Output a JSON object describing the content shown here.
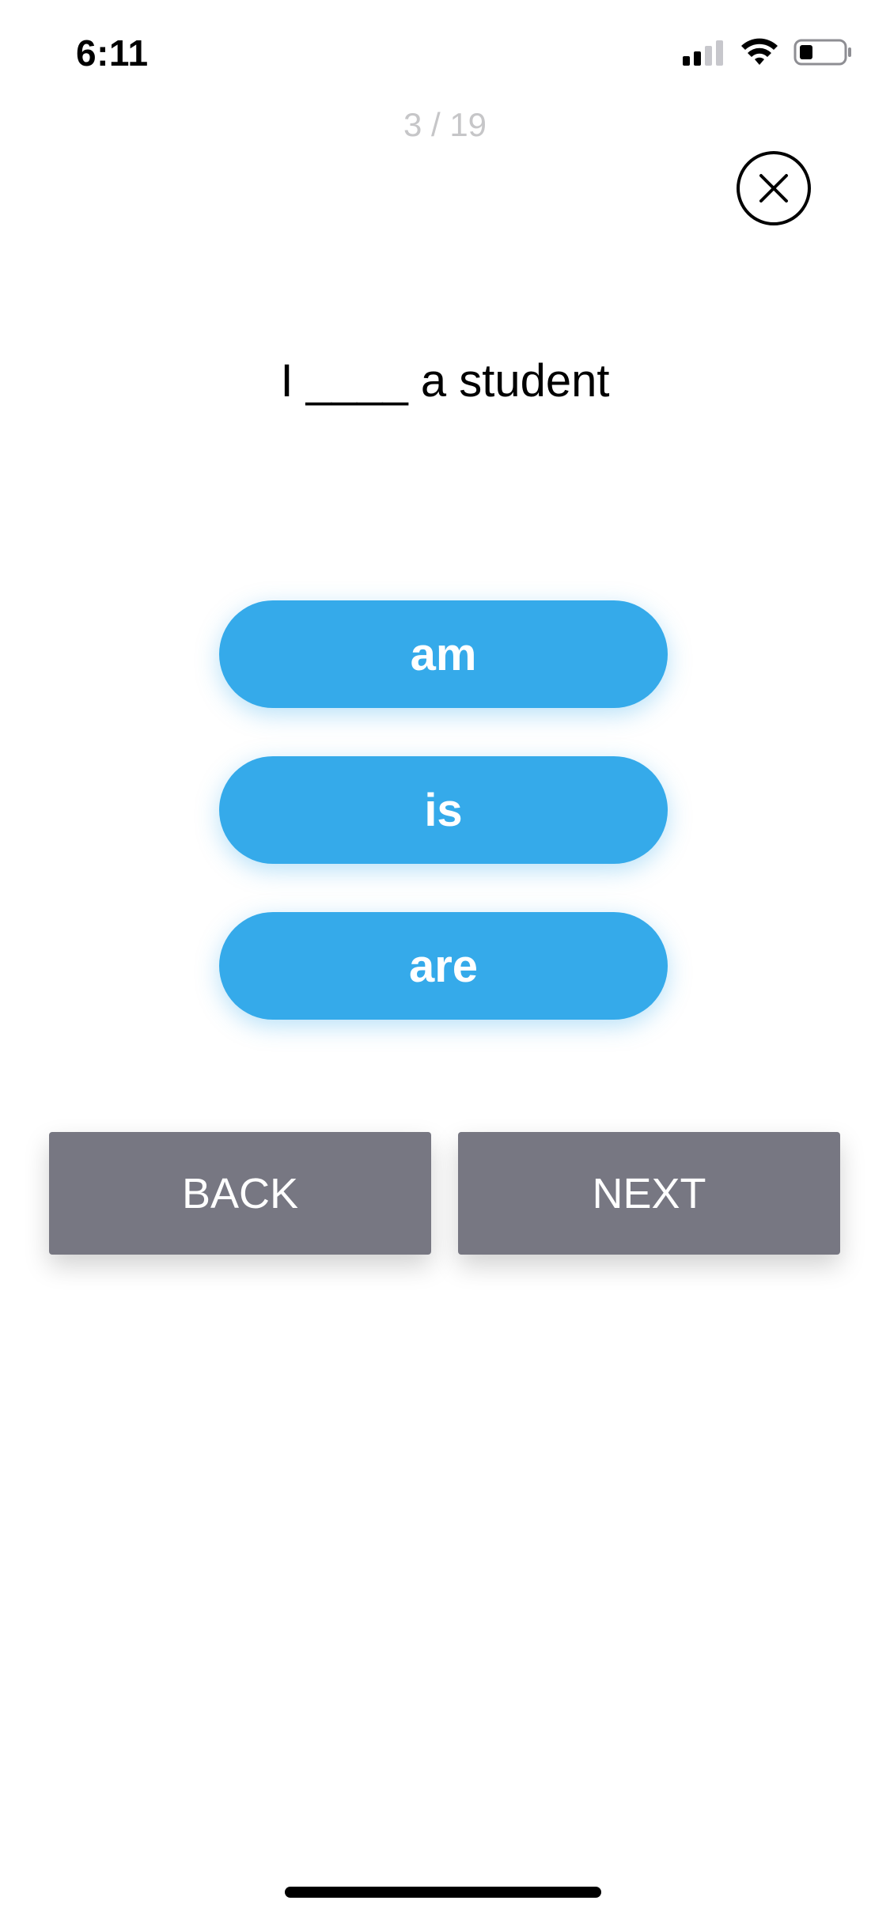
{
  "status_bar": {
    "time": "6:11",
    "icons": [
      "cellular-signal-icon",
      "wifi-icon",
      "battery-icon"
    ]
  },
  "progress": {
    "label": "3 / 19",
    "current": 3,
    "total": 19
  },
  "close": {
    "icon": "close-circle-icon"
  },
  "question": {
    "prompt": "I ____ a student"
  },
  "options": [
    {
      "label": "am"
    },
    {
      "label": "is"
    },
    {
      "label": "are"
    }
  ],
  "navigation": {
    "back_label": "BACK",
    "next_label": "NEXT"
  },
  "colors": {
    "option_background": "#35aaea",
    "nav_background": "#777782",
    "counter_text": "#c6c6c8"
  }
}
